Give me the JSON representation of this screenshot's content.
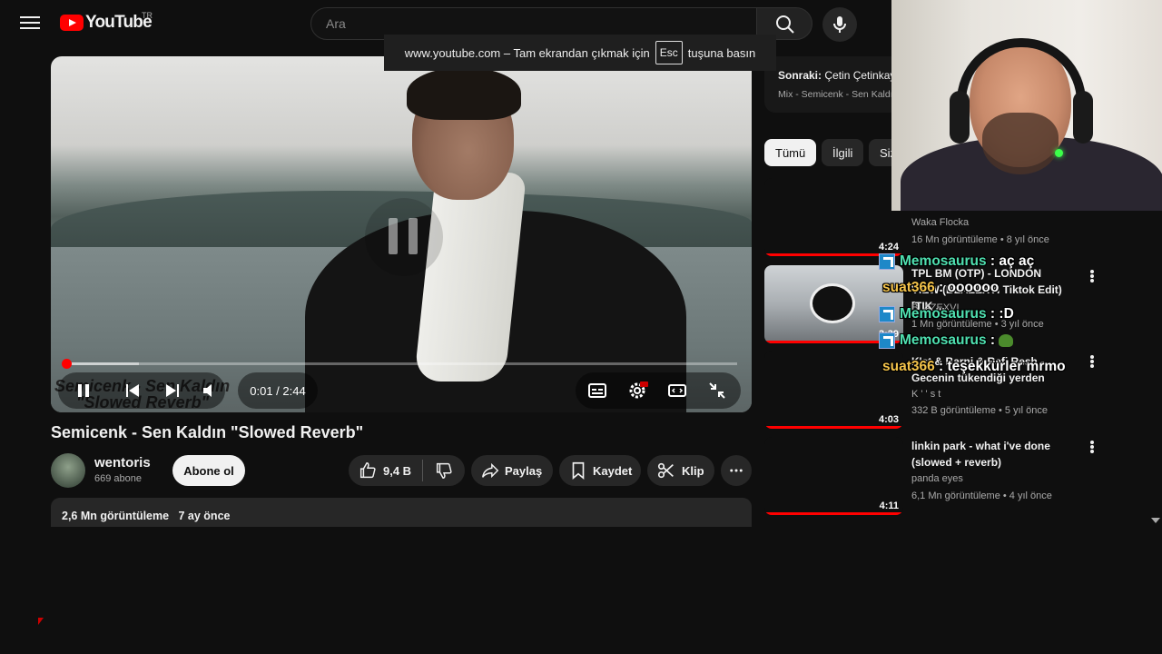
{
  "masthead": {
    "logo_text": "YouTube",
    "country_code": "TR",
    "search_placeholder": "Ara"
  },
  "fullscreen_toast": {
    "prefix": "www.youtube.com – Tam ekrandan çıkmak için",
    "key": "Esc",
    "suffix": "tuşuna basın"
  },
  "player": {
    "burned_title_line1": "Semicenk - Sen Kaldın",
    "burned_title_line2": "\"Slowed Reverb\"",
    "time": "0:01 / 2:44",
    "progress_fraction": 0.006,
    "buffered_fraction": 0.11
  },
  "video": {
    "title": "Semicenk - Sen Kaldın \"Slowed Reverb\"",
    "channel": "wentoris",
    "subscribers": "669 abone",
    "subscribe_label": "Abone ol",
    "likes": "9,4 B",
    "share_label": "Paylaş",
    "save_label": "Kaydet",
    "clip_label": "Klip",
    "views": "2,6 Mn görüntüleme",
    "age": "7 ay önce"
  },
  "up_next": {
    "prefix": "Sonraki:",
    "title": "Çetin Çetinkaya",
    "subtitle": "Mix - Semicenk - Sen Kaldın"
  },
  "chips": [
    "Tümü",
    "İlgili",
    "Siz"
  ],
  "related": [
    {
      "title": "",
      "channel": "Waka Flocka",
      "meta": "16 Mn görüntüleme • 8 yıl önce",
      "duration": "4:24"
    },
    {
      "title": "TPL BM (OTP) - LONDON VIEW (BLAZEXVI Tiktok Edit) [TIK ...",
      "channel": "BLAZEXVI",
      "meta": "1 Mn görüntüleme • 3 yıl önce",
      "duration": "3:39"
    },
    {
      "title": "K'st & Barni & Rafi Resh - Gecenin tükendiği yerden",
      "channel": "K ' ' s t",
      "meta": "332 B görüntüleme • 5 yıl önce",
      "duration": "4:03"
    },
    {
      "title": "linkin park - what i've done (slowed + reverb)",
      "channel": "panda eyes",
      "meta": "6,1 Mn görüntüleme • 4 yıl önce",
      "duration": "4:11"
    }
  ],
  "chat": [
    {
      "user": "Memosaurus",
      "message": "aç aç",
      "badge": true
    },
    {
      "user": "suat366",
      "message": "oooooo",
      "badge": false
    },
    {
      "user": "Memosaurus",
      "message": ":D",
      "badge": true
    },
    {
      "user": "Memosaurus",
      "message": "",
      "badge": true
    },
    {
      "user": "suat366",
      "message": "teşekkürler mrmo",
      "badge": false
    }
  ],
  "colors": {
    "accent": "#ff0000",
    "background": "#0f0f0f",
    "chat_user_1": "#4fe0b0",
    "chat_user_2": "#f2c24a"
  }
}
